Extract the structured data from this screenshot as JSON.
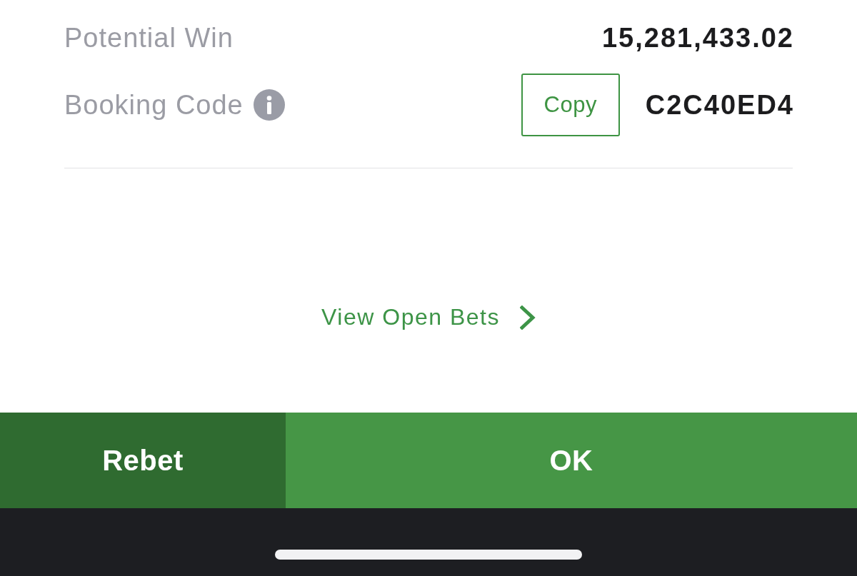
{
  "summary": [
    {
      "label": "Potential Win",
      "value": "15,281,433.02"
    },
    {
      "label": "Booking Code",
      "info": true,
      "copy_button": "Copy",
      "value": "C2C40ED4"
    }
  ],
  "link": {
    "label": "View Open Bets"
  },
  "actions": [
    {
      "label": "Rebet",
      "kind": "secondary"
    },
    {
      "label": "OK",
      "kind": "primary"
    }
  ]
}
